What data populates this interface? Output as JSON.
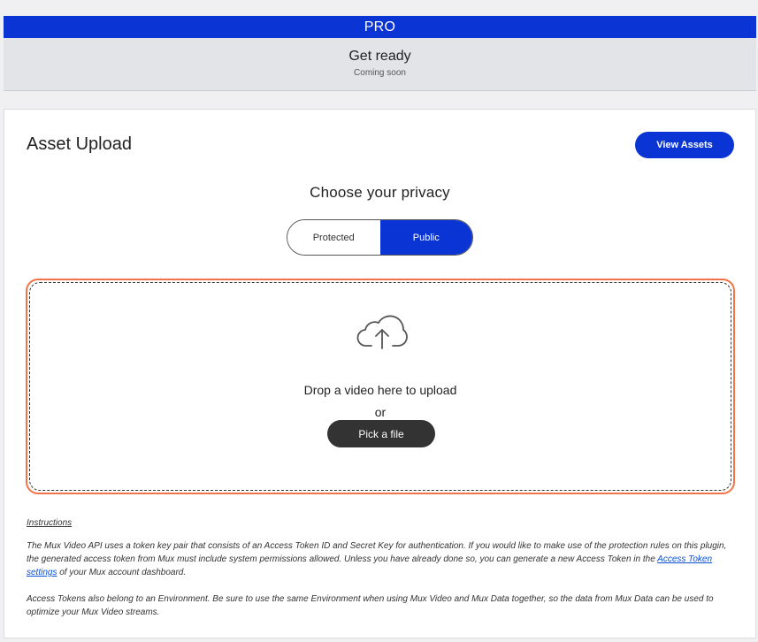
{
  "banner": {
    "label": "PRO"
  },
  "status": {
    "title": "Get ready",
    "subtitle": "Coming soon"
  },
  "upload": {
    "title": "Asset Upload",
    "view_assets_label": "View Assets",
    "privacy_heading": "Choose your privacy",
    "privacy_options": [
      {
        "label": "Protected",
        "selected": false
      },
      {
        "label": "Public",
        "selected": true
      }
    ],
    "dropzone": {
      "icon": "cloud-upload-icon",
      "drop_text": "Drop a video here to upload",
      "or_text": "or",
      "pick_label": "Pick a file"
    }
  },
  "instructions": {
    "heading": "Instructions",
    "p1_before": "The Mux Video API uses a token key pair that consists of an Access Token ID and Secret Key for authentication. If you would like to make use of the protection rules on this plugin, the generated access token from Mux must include system permissions allowed. Unless you have already done so, you can generate a new Access Token in the ",
    "p1_link": "Access Token settings",
    "p1_after": " of your Mux account dashboard.",
    "p2": "Access Tokens also belong to an Environment. Be sure to use the same Environment when using Mux Video and Mux Data together, so the data from Mux Data can be used to optimize your Mux Video streams."
  },
  "colors": {
    "accent": "#0a34d4",
    "dropzone_border": "#f07448",
    "dark_button": "#333333"
  }
}
